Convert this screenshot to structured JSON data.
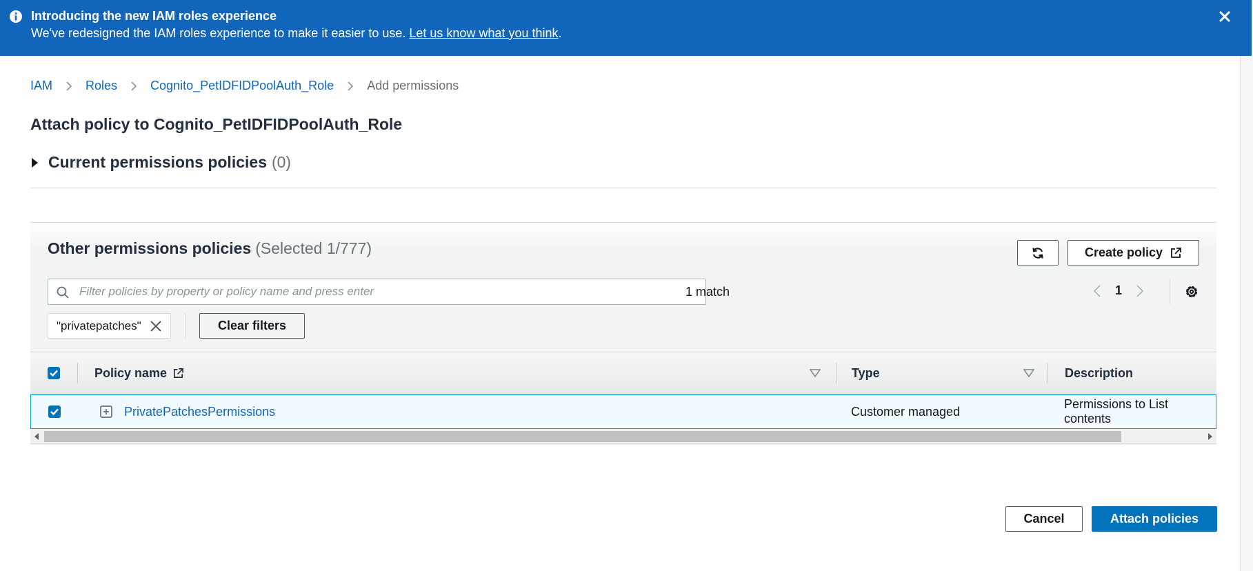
{
  "banner": {
    "title": "Introducing the new IAM roles experience",
    "text": "We've redesigned the IAM roles experience to make it easier to use. ",
    "link": "Let us know what you think",
    "period": "."
  },
  "breadcrumb": {
    "items": [
      "IAM",
      "Roles",
      "Cognito_PetIDFIDPoolAuth_Role"
    ],
    "current": "Add permissions"
  },
  "page": {
    "title": "Attach policy to Cognito_PetIDFIDPoolAuth_Role"
  },
  "current_permissions": {
    "label": "Current permissions policies",
    "count": "(0)"
  },
  "other_permissions": {
    "label": "Other permissions policies",
    "selected": "(Selected 1/777)",
    "create_policy_label": "Create policy",
    "search_placeholder": "Filter policies by property or policy name and press enter",
    "match_text": "1 match",
    "page_number": "1",
    "filter_token": "\"privatepatches\"",
    "clear_filters_label": "Clear filters"
  },
  "table": {
    "headers": {
      "policy_name": "Policy name",
      "type": "Type",
      "description": "Description"
    },
    "rows": [
      {
        "name": "PrivatePatchesPermissions",
        "type": "Customer managed",
        "description": "Permissions to List contents",
        "checked": true
      }
    ]
  },
  "footer": {
    "cancel_label": "Cancel",
    "attach_label": "Attach policies"
  },
  "colors": {
    "banner": "#1166bb",
    "link": "#1166bb",
    "primary_button": "#0073bb",
    "selected_row": "#f1faff"
  }
}
